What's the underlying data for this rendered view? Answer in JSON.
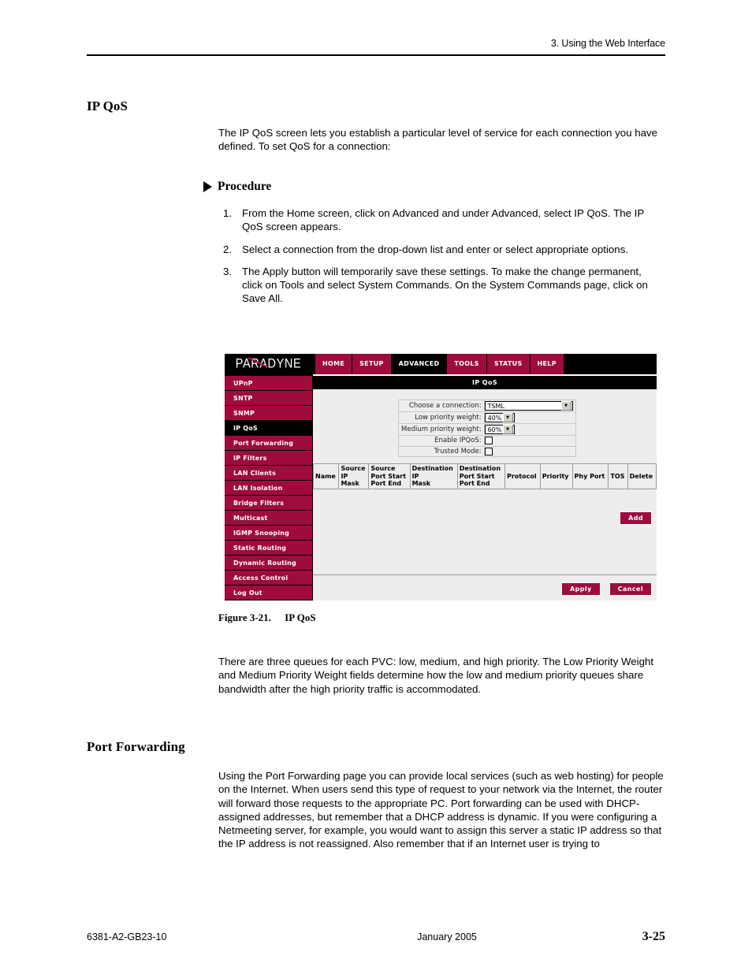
{
  "header": {
    "running_head": "3. Using the Web Interface"
  },
  "sections": {
    "ipqos_heading": "IP QoS",
    "intro_paragraph": "The IP QoS screen lets you establish a particular level of service for each connection you have defined. To set QoS for a connection:",
    "procedure_label": "Procedure",
    "procedure_steps": [
      {
        "num": "1.",
        "text": "From the Home screen, click on Advanced and under Advanced, select IP QoS. The IP QoS screen appears."
      },
      {
        "num": "2.",
        "text": "Select a connection from the drop-down list and enter or select appropriate options."
      },
      {
        "num": "3.",
        "text": "The Apply button will temporarily save these settings. To make the change permanent, click on Tools and select System Commands. On the System Commands page, click on Save All."
      }
    ],
    "queues_paragraph": "There are three queues for each PVC: low, medium, and high priority. The Low Priority Weight and Medium Priority Weight fields determine how the low and medium priority queues share bandwidth after the high priority traffic is accommodated.",
    "portforwarding_heading": "Port Forwarding",
    "portforwarding_paragraph": "Using the Port Forwarding page you can provide local services (such as web hosting) for people on the Internet. When users send this type of request to your network via the Internet, the router will forward those requests to the appropriate PC. Port forwarding can be used with DHCP-assigned addresses, but remember that a DHCP address is dynamic. If you were configuring a Netmeeting server, for example, you would want to assign this server a static IP address so that the IP address is not reassigned. Also remember that if an Internet user is trying to"
  },
  "figure": {
    "caption_number": "Figure 3-21.",
    "caption_title": "IP QoS",
    "brand": "PARADYNE",
    "nav_tabs": [
      {
        "label": "HOME",
        "active": false
      },
      {
        "label": "SETUP",
        "active": false
      },
      {
        "label": "ADVANCED",
        "active": true
      },
      {
        "label": "TOOLS",
        "active": false
      },
      {
        "label": "STATUS",
        "active": false
      },
      {
        "label": "HELP",
        "active": false
      }
    ],
    "sidebar_items": [
      {
        "label": "UPnP",
        "active": false
      },
      {
        "label": "SNTP",
        "active": false
      },
      {
        "label": "SNMP",
        "active": false
      },
      {
        "label": "IP QoS",
        "active": true
      },
      {
        "label": "Port Forwarding",
        "active": false
      },
      {
        "label": "IP Filters",
        "active": false
      },
      {
        "label": "LAN Clients",
        "active": false
      },
      {
        "label": "LAN Isolation",
        "active": false
      },
      {
        "label": "Bridge Filters",
        "active": false
      },
      {
        "label": "Multicast",
        "active": false
      },
      {
        "label": "IGMP Snooping",
        "active": false
      },
      {
        "label": "Static Routing",
        "active": false
      },
      {
        "label": "Dynamic Routing",
        "active": false
      },
      {
        "label": "Access Control",
        "active": false
      },
      {
        "label": "Log Out",
        "active": false
      }
    ],
    "content_title": "IP QoS",
    "form": {
      "connection_label": "Choose a connection:",
      "connection_value": "TSML",
      "low_weight_label": "Low priority weight:",
      "low_weight_value": "40%",
      "medium_weight_label": "Medium priority weight:",
      "medium_weight_value": "60%",
      "enable_label": "Enable IPQoS:",
      "enable_checked": false,
      "trusted_label": "Trusted Mode:",
      "trusted_checked": false
    },
    "rules_table": {
      "columns": [
        {
          "l1": "",
          "l2": "Name",
          "l3": ""
        },
        {
          "l1": "Source",
          "l2": "IP",
          "l3": "Mask"
        },
        {
          "l1": "Source",
          "l2": "Port Start",
          "l3": "Port End"
        },
        {
          "l1": "Destination",
          "l2": "IP",
          "l3": "Mask"
        },
        {
          "l1": "Destination",
          "l2": "Port Start",
          "l3": "Port End"
        },
        {
          "l1": "",
          "l2": "Protocol",
          "l3": ""
        },
        {
          "l1": "",
          "l2": "Priority",
          "l3": ""
        },
        {
          "l1": "",
          "l2": "Phy Port",
          "l3": ""
        },
        {
          "l1": "",
          "l2": "TOS",
          "l3": ""
        },
        {
          "l1": "",
          "l2": "Delete",
          "l3": ""
        }
      ],
      "rows": []
    },
    "buttons": {
      "add": "Add",
      "apply": "Apply",
      "cancel": "Cancel"
    },
    "colors": {
      "brand_crimson": "#9E0B3C",
      "nav_active": "#000000",
      "content_bg": "#EDEDED"
    }
  },
  "footer": {
    "doc_number": "6381-A2-GB23-10",
    "date": "January 2005",
    "page": "3-25"
  }
}
